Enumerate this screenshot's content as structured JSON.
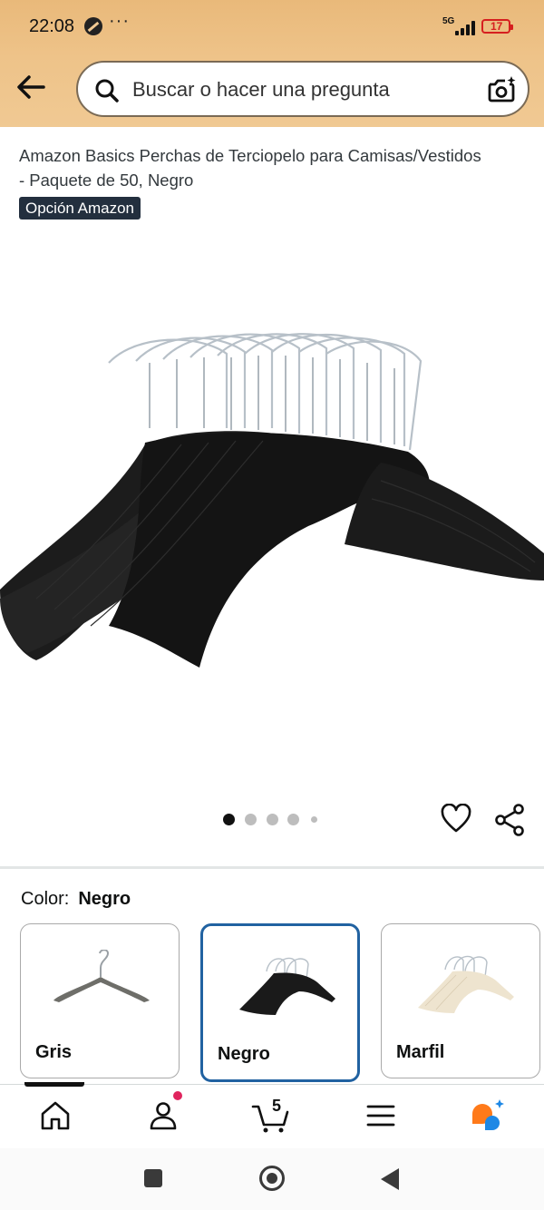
{
  "status_bar": {
    "time": "22:08",
    "more": "···",
    "network": "5G",
    "battery": "17"
  },
  "search": {
    "placeholder": "Buscar o hacer una pregunta"
  },
  "product": {
    "title": "Amazon Basics Perchas de Terciopelo para Camisas/Vestidos - Paquete de 50, Negro",
    "badge": "Opción Amazon",
    "image_icon": "black-velvet-hangers-image",
    "image_count": 5,
    "active_image": 1
  },
  "color": {
    "label": "Color:",
    "selected": "Negro",
    "options": [
      {
        "name": "Gris",
        "selected": false
      },
      {
        "name": "Negro",
        "selected": true
      },
      {
        "name": "Marfil",
        "selected": false
      }
    ]
  },
  "bottom_nav": {
    "items": [
      "home-icon",
      "account-icon",
      "cart-icon",
      "menu-icon",
      "rufus-icon"
    ],
    "cart_count": "5"
  },
  "colors": {
    "header": "#eec389",
    "selected_border": "#2162a1",
    "badge_bg": "#232f3e",
    "notification": "#e0245e",
    "rufus_orange": "#ff7a1a",
    "rufus_blue": "#1e88e5"
  }
}
